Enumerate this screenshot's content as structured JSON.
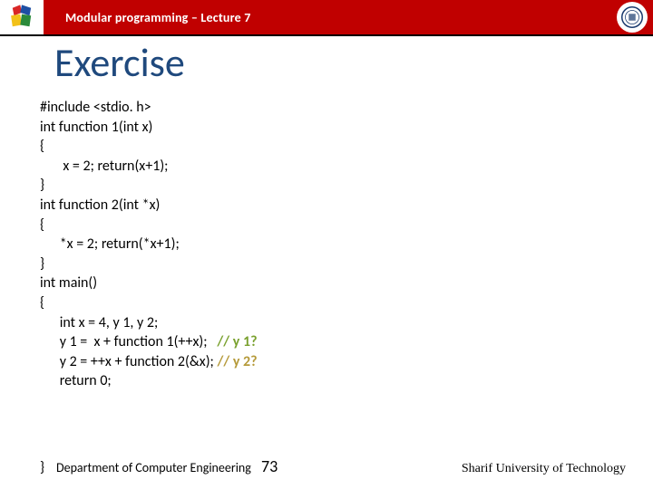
{
  "header": {
    "title": "Modular programming – Lecture 7"
  },
  "page_title": "Exercise",
  "code": {
    "l1": "#include <stdio. h>",
    "l2": "int function 1(int x)",
    "l3": "{",
    "l4": "       x = 2; return(x+1);",
    "l5": "}",
    "l6": "int function 2(int *x)",
    "l7": "{",
    "l8": "      *x = 2; return(*x+1);",
    "l9": "}",
    "l10": "int main()",
    "l11": "{",
    "l12": "      int x = 4, y 1, y 2;",
    "l13a": "      y 1 =  x + function 1(++x);   ",
    "l13b": "// y 1?",
    "l14a": "      y 2 = ++x + function 2(&x); ",
    "l14b": "// y 2?",
    "l15": "      return 0;"
  },
  "footer": {
    "dept": "Department of Computer Engineering",
    "page": "73",
    "univ": "Sharif University of Technology",
    "brace": "}"
  }
}
